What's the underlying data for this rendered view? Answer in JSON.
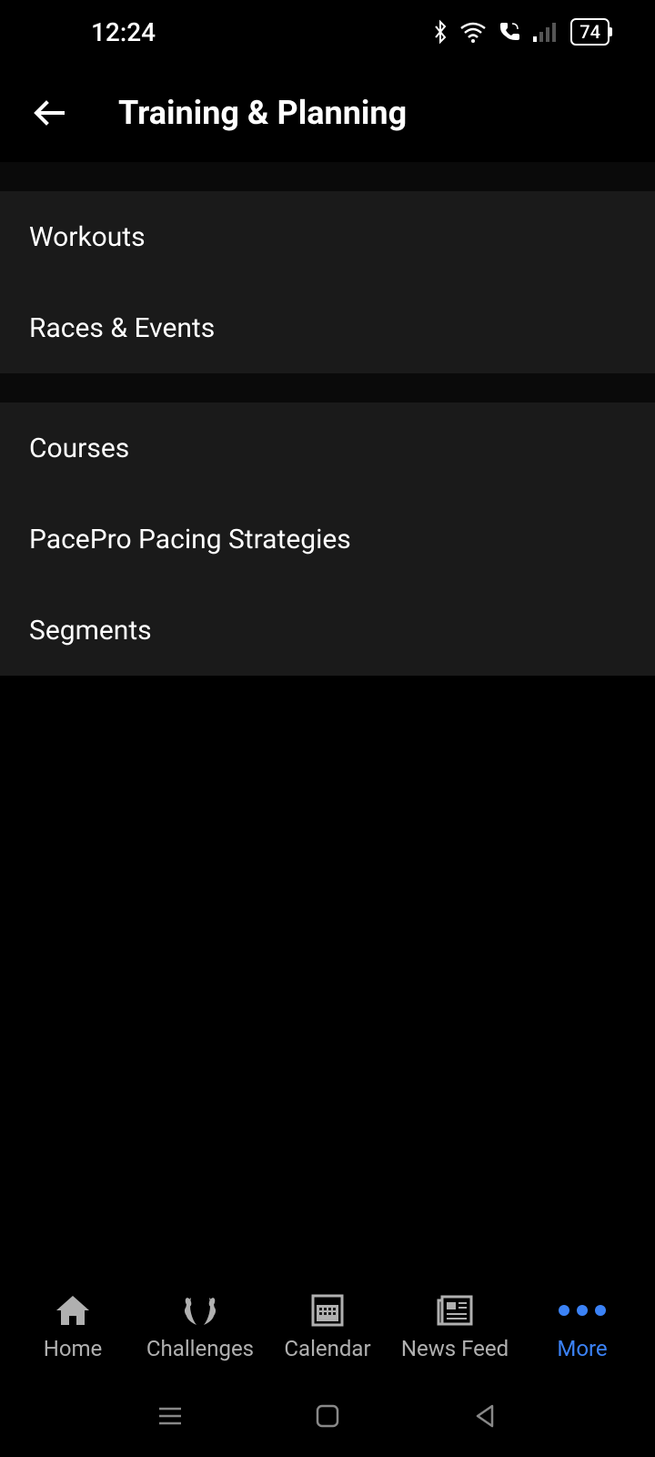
{
  "statusBar": {
    "time": "12:24",
    "battery": "74"
  },
  "header": {
    "title": "Training & Planning"
  },
  "sections": [
    {
      "items": [
        {
          "label": "Workouts"
        },
        {
          "label": "Races & Events"
        }
      ]
    },
    {
      "items": [
        {
          "label": "Courses"
        },
        {
          "label": "PacePro Pacing Strategies"
        },
        {
          "label": "Segments"
        }
      ]
    }
  ],
  "bottomNav": {
    "items": [
      {
        "label": "Home",
        "icon": "home",
        "active": false
      },
      {
        "label": "Challenges",
        "icon": "laurel",
        "active": false
      },
      {
        "label": "Calendar",
        "icon": "calendar",
        "active": false
      },
      {
        "label": "News Feed",
        "icon": "news",
        "active": false
      },
      {
        "label": "More",
        "icon": "more",
        "active": true
      }
    ]
  },
  "colors": {
    "accent": "#3b82f6",
    "background": "#000000",
    "section": "#1a1a1a",
    "text": "#ffffff",
    "textMuted": "#b0b0b0"
  }
}
